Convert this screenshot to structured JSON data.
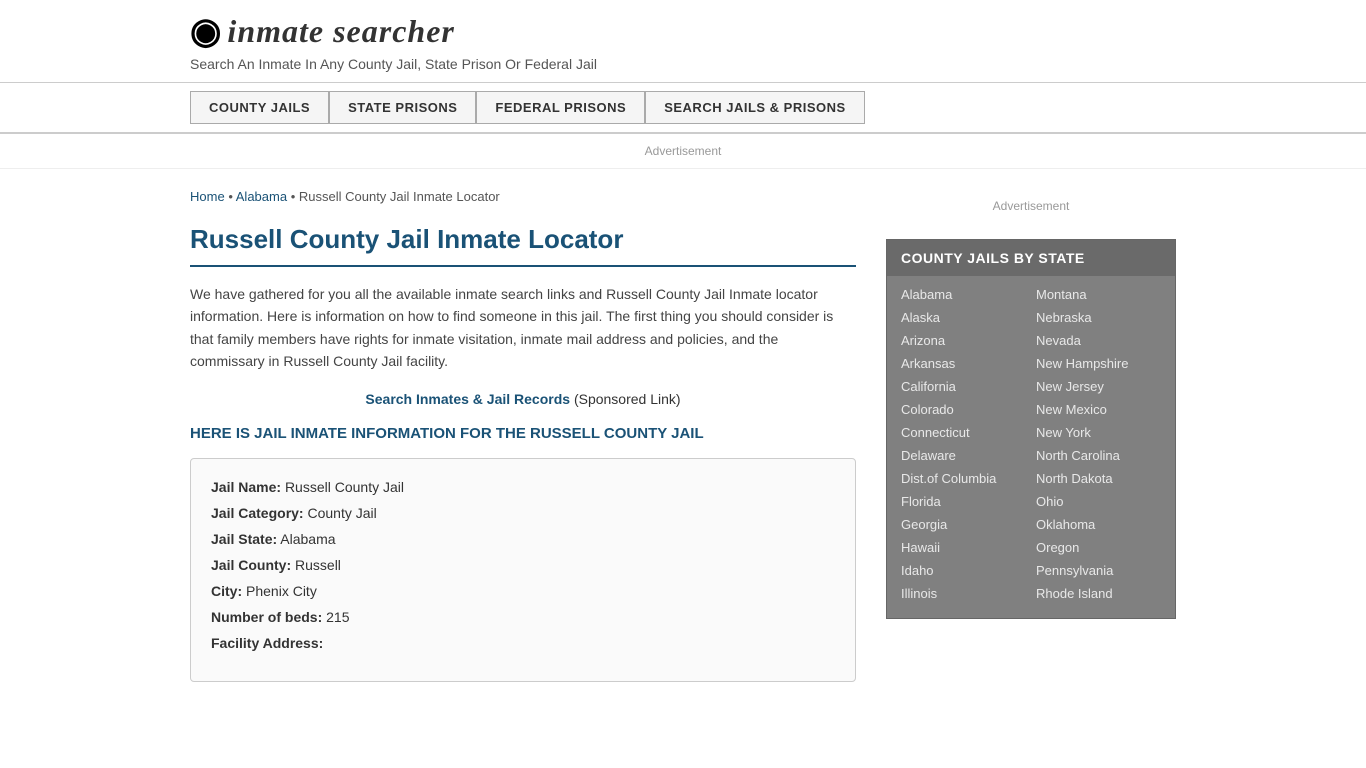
{
  "header": {
    "logo_icon": "🔍",
    "logo_text": "inmate searcher",
    "tagline": "Search An Inmate In Any County Jail, State Prison Or Federal Jail"
  },
  "nav": {
    "items": [
      {
        "id": "county-jails",
        "label": "COUNTY JAILS"
      },
      {
        "id": "state-prisons",
        "label": "STATE PRISONS"
      },
      {
        "id": "federal-prisons",
        "label": "FEDERAL PRISONS"
      },
      {
        "id": "search-jails",
        "label": "SEARCH JAILS & PRISONS"
      }
    ]
  },
  "ad": {
    "label": "Advertisement"
  },
  "breadcrumb": {
    "home": "Home",
    "state": "Alabama",
    "current": "Russell County Jail Inmate Locator"
  },
  "page_title": "Russell County Jail Inmate Locator",
  "description": "We have gathered for you all the available inmate search links and Russell County Jail Inmate locator information. Here is information on how to find someone in this jail. The first thing you should consider is that family members have rights for inmate visitation, inmate mail address and policies, and the commissary in Russell County Jail facility.",
  "sponsored": {
    "link_text": "Search Inmates & Jail Records",
    "label": "(Sponsored Link)"
  },
  "section_heading": "HERE IS JAIL INMATE INFORMATION FOR THE RUSSELL COUNTY JAIL",
  "jail_info": {
    "name_label": "Jail Name:",
    "name_value": "Russell County Jail",
    "category_label": "Jail Category:",
    "category_value": "County Jail",
    "state_label": "Jail State:",
    "state_value": "Alabama",
    "county_label": "Jail County:",
    "county_value": "Russell",
    "city_label": "City:",
    "city_value": "Phenix City",
    "beds_label": "Number of beds:",
    "beds_value": "215",
    "address_label": "Facility Address:"
  },
  "sidebar": {
    "ad_label": "Advertisement",
    "state_box_title": "COUNTY JAILS BY STATE",
    "states_left": [
      "Alabama",
      "Alaska",
      "Arizona",
      "Arkansas",
      "California",
      "Colorado",
      "Connecticut",
      "Delaware",
      "Dist.of Columbia",
      "Florida",
      "Georgia",
      "Hawaii",
      "Idaho",
      "Illinois"
    ],
    "states_right": [
      "Montana",
      "Nebraska",
      "Nevada",
      "New Hampshire",
      "New Jersey",
      "New Mexico",
      "New York",
      "North Carolina",
      "North Dakota",
      "Ohio",
      "Oklahoma",
      "Oregon",
      "Pennsylvania",
      "Rhode Island"
    ]
  }
}
